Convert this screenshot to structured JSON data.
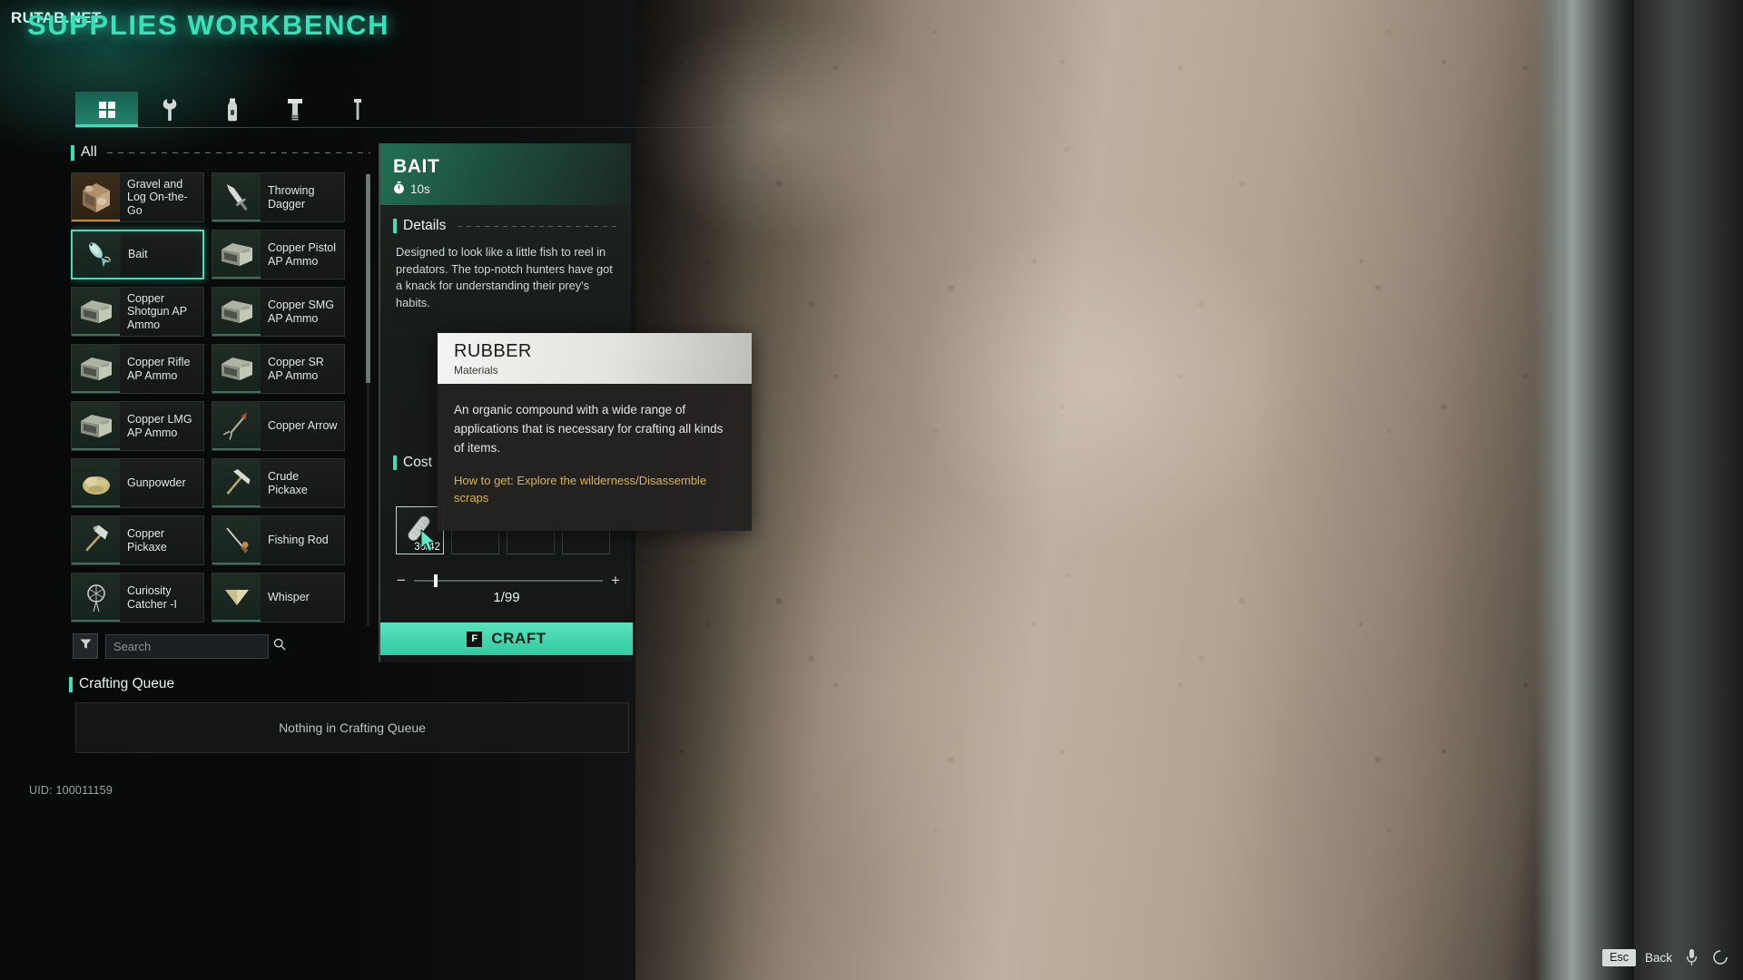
{
  "watermark": "RUTAB.NET",
  "header": {
    "title": "SUPPLIES WORKBENCH"
  },
  "tabs": [
    {
      "id": "all",
      "icon": "grid-icon",
      "active": true
    },
    {
      "id": "tools",
      "icon": "wrench-icon",
      "active": false
    },
    {
      "id": "consumables",
      "icon": "bottle-icon",
      "active": false
    },
    {
      "id": "parts",
      "icon": "bolt-icon",
      "active": false
    },
    {
      "id": "ammo",
      "icon": "nail-icon",
      "active": false
    }
  ],
  "category": {
    "label": "All"
  },
  "items": [
    {
      "name": "Gravel and Log On-the-Go",
      "icon": "crate-icon",
      "rarity": "rare",
      "selected": false
    },
    {
      "name": "Throwing Dagger",
      "icon": "dagger-icon",
      "rarity": "common",
      "selected": false
    },
    {
      "name": "Bait",
      "icon": "bait-icon",
      "rarity": "common",
      "selected": true
    },
    {
      "name": "Copper Pistol AP Ammo",
      "icon": "ammobox-icon",
      "rarity": "common",
      "selected": false
    },
    {
      "name": "Copper Shotgun AP Ammo",
      "icon": "ammobox-icon",
      "rarity": "common",
      "selected": false
    },
    {
      "name": "Copper SMG AP Ammo",
      "icon": "ammobox-icon",
      "rarity": "common",
      "selected": false
    },
    {
      "name": "Copper Rifle AP Ammo",
      "icon": "ammobox-icon",
      "rarity": "common",
      "selected": false
    },
    {
      "name": "Copper SR AP Ammo",
      "icon": "ammobox-icon",
      "rarity": "common",
      "selected": false
    },
    {
      "name": "Copper LMG AP Ammo",
      "icon": "ammobox-icon",
      "rarity": "common",
      "selected": false
    },
    {
      "name": "Copper Arrow",
      "icon": "arrow-icon",
      "rarity": "common",
      "selected": false
    },
    {
      "name": "Gunpowder",
      "icon": "powder-icon",
      "rarity": "common",
      "selected": false
    },
    {
      "name": "Crude Pickaxe",
      "icon": "pickaxe-icon",
      "rarity": "common",
      "selected": false
    },
    {
      "name": "Copper Pickaxe",
      "icon": "axe-icon",
      "rarity": "common",
      "selected": false
    },
    {
      "name": "Fishing Rod",
      "icon": "rod-icon",
      "rarity": "common",
      "selected": false
    },
    {
      "name": "Curiosity Catcher -I",
      "icon": "catcher-icon",
      "rarity": "common",
      "selected": false
    },
    {
      "name": "Whisper",
      "icon": "whisper-icon",
      "rarity": "common",
      "selected": false
    }
  ],
  "search": {
    "placeholder": "Search",
    "value": ""
  },
  "queue": {
    "title": "Crafting Queue",
    "empty_text": "Nothing in Crafting Queue"
  },
  "uid": "UID: 100011159",
  "detail": {
    "title": "BAIT",
    "craft_time": "10s",
    "details_label": "Details",
    "description": "Designed to look like a little fish to reel in predators. The top-notch hunters have got a knack for understanding their prey's habits.",
    "cost_label": "Cost",
    "cost_slots": [
      {
        "icon": "rubber-icon",
        "qty": "30/42"
      },
      {
        "icon": "",
        "qty": ""
      },
      {
        "icon": "",
        "qty": ""
      },
      {
        "icon": "",
        "qty": ""
      }
    ],
    "quantity": "1/99",
    "minus": "−",
    "plus": "+",
    "craft_key": "F",
    "craft_label": "CRAFT"
  },
  "tooltip": {
    "title": "RUBBER",
    "subtitle": "Materials",
    "description": "An organic compound with a wide range of applications that is necessary for crafting all kinds of items.",
    "how_to_get": "How to get: Explore the wilderness/Disassemble scraps"
  },
  "footer": {
    "esc_key": "Esc",
    "back_label": "Back"
  },
  "colors": {
    "accent": "#3ae0ba",
    "rare": "#c28a2c",
    "gold_text": "#d7b54a",
    "craft_button": "#3fd4ad"
  }
}
